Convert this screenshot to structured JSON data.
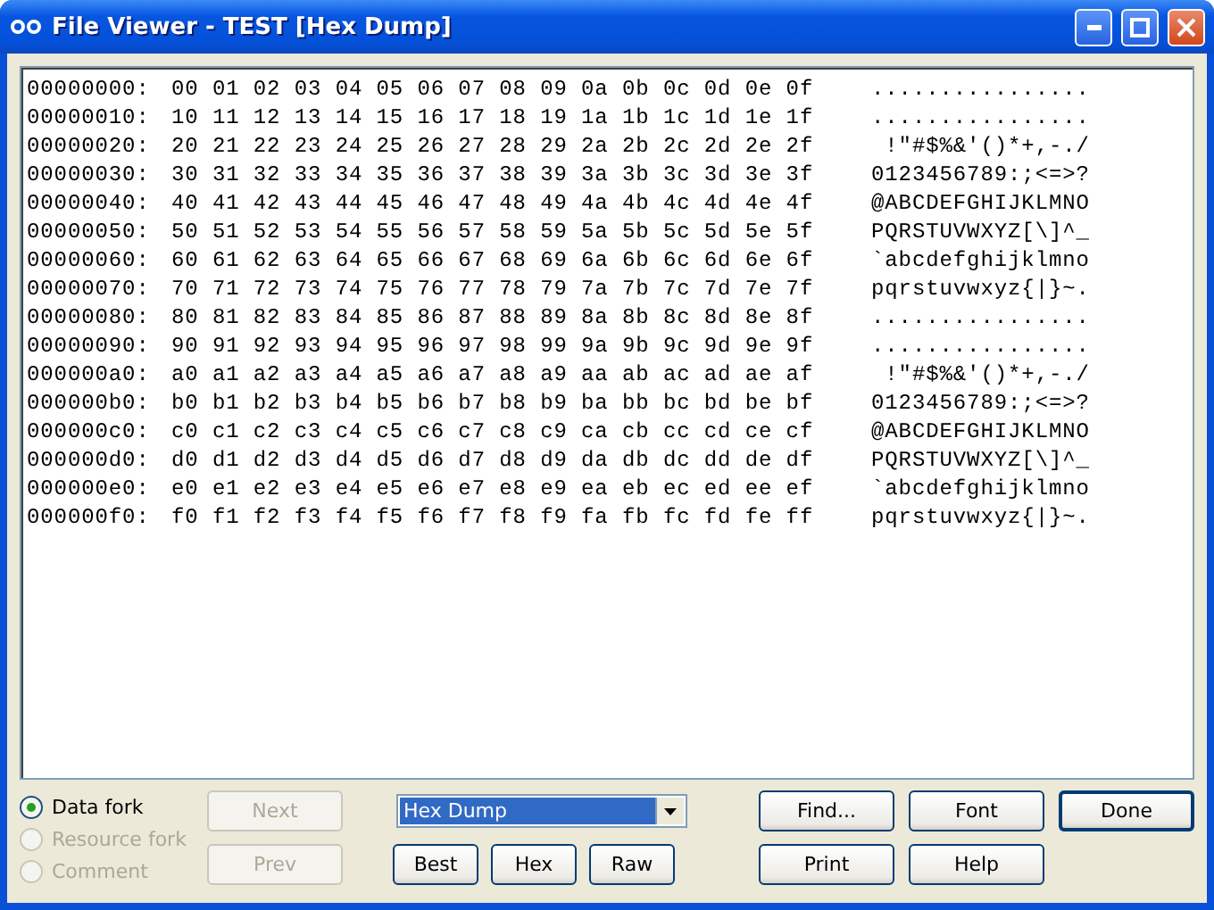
{
  "window": {
    "title": "File Viewer - TEST [Hex Dump]"
  },
  "dump": [
    {
      "offset": "00000000:",
      "hex": "00 01 02 03 04 05 06 07 08 09 0a 0b 0c 0d 0e 0f",
      "ascii": "................"
    },
    {
      "offset": "00000010:",
      "hex": "10 11 12 13 14 15 16 17 18 19 1a 1b 1c 1d 1e 1f",
      "ascii": "................"
    },
    {
      "offset": "00000020:",
      "hex": "20 21 22 23 24 25 26 27 28 29 2a 2b 2c 2d 2e 2f",
      "ascii": " !\"#$%&'()*+,-./"
    },
    {
      "offset": "00000030:",
      "hex": "30 31 32 33 34 35 36 37 38 39 3a 3b 3c 3d 3e 3f",
      "ascii": "0123456789:;<=>?"
    },
    {
      "offset": "00000040:",
      "hex": "40 41 42 43 44 45 46 47 48 49 4a 4b 4c 4d 4e 4f",
      "ascii": "@ABCDEFGHIJKLMNO"
    },
    {
      "offset": "00000050:",
      "hex": "50 51 52 53 54 55 56 57 58 59 5a 5b 5c 5d 5e 5f",
      "ascii": "PQRSTUVWXYZ[\\]^_"
    },
    {
      "offset": "00000060:",
      "hex": "60 61 62 63 64 65 66 67 68 69 6a 6b 6c 6d 6e 6f",
      "ascii": "`abcdefghijklmno"
    },
    {
      "offset": "00000070:",
      "hex": "70 71 72 73 74 75 76 77 78 79 7a 7b 7c 7d 7e 7f",
      "ascii": "pqrstuvwxyz{|}~."
    },
    {
      "offset": "00000080:",
      "hex": "80 81 82 83 84 85 86 87 88 89 8a 8b 8c 8d 8e 8f",
      "ascii": "................"
    },
    {
      "offset": "00000090:",
      "hex": "90 91 92 93 94 95 96 97 98 99 9a 9b 9c 9d 9e 9f",
      "ascii": "................"
    },
    {
      "offset": "000000a0:",
      "hex": "a0 a1 a2 a3 a4 a5 a6 a7 a8 a9 aa ab ac ad ae af",
      "ascii": " !\"#$%&'()*+,-./"
    },
    {
      "offset": "000000b0:",
      "hex": "b0 b1 b2 b3 b4 b5 b6 b7 b8 b9 ba bb bc bd be bf",
      "ascii": "0123456789:;<=>?"
    },
    {
      "offset": "000000c0:",
      "hex": "c0 c1 c2 c3 c4 c5 c6 c7 c8 c9 ca cb cc cd ce cf",
      "ascii": "@ABCDEFGHIJKLMNO"
    },
    {
      "offset": "000000d0:",
      "hex": "d0 d1 d2 d3 d4 d5 d6 d7 d8 d9 da db dc dd de df",
      "ascii": "PQRSTUVWXYZ[\\]^_"
    },
    {
      "offset": "000000e0:",
      "hex": "e0 e1 e2 e3 e4 e5 e6 e7 e8 e9 ea eb ec ed ee ef",
      "ascii": "`abcdefghijklmno"
    },
    {
      "offset": "000000f0:",
      "hex": "f0 f1 f2 f3 f4 f5 f6 f7 f8 f9 fa fb fc fd fe ff",
      "ascii": "pqrstuvwxyz{|}~."
    }
  ],
  "forks": [
    {
      "label": "Data fork",
      "selected": true,
      "disabled": false
    },
    {
      "label": "Resource fork",
      "selected": false,
      "disabled": true
    },
    {
      "label": "Comment",
      "selected": false,
      "disabled": true
    }
  ],
  "nav_buttons": [
    {
      "label": "Next",
      "disabled": true
    },
    {
      "label": "Prev",
      "disabled": true
    }
  ],
  "view_select": {
    "value": "Hex Dump"
  },
  "mode_buttons": [
    "Best",
    "Hex",
    "Raw"
  ],
  "action_buttons": [
    {
      "label": "Find...",
      "default": false
    },
    {
      "label": "Font",
      "default": false
    },
    {
      "label": "Done",
      "default": true
    },
    {
      "label": "Print",
      "default": false
    },
    {
      "label": "Help",
      "default": false
    }
  ]
}
